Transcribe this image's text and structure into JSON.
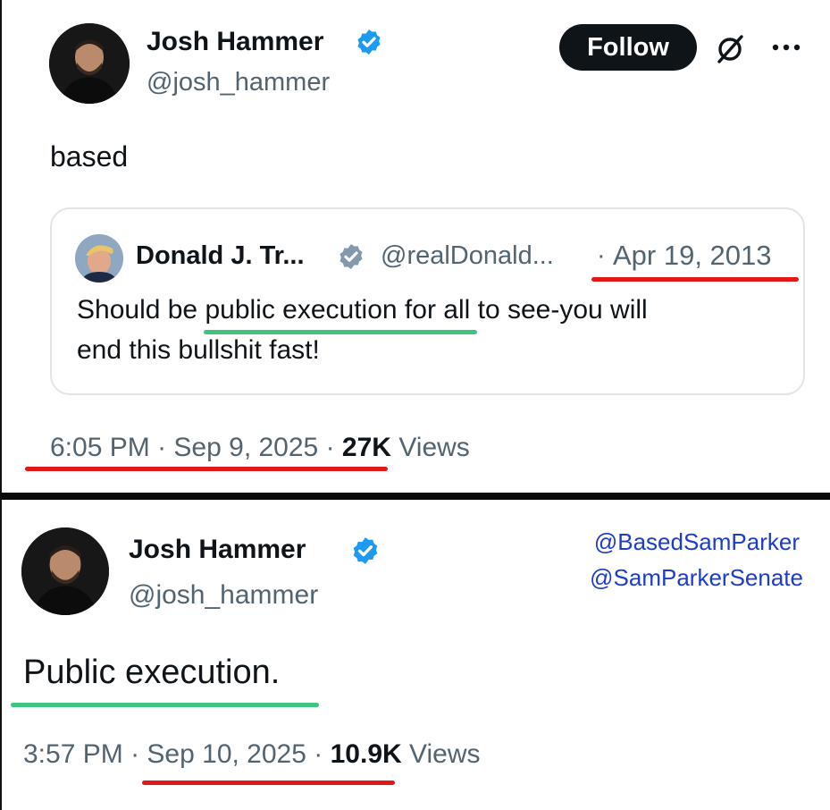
{
  "tweet1": {
    "author_name": "Josh Hammer",
    "author_handle": "@josh_hammer",
    "follow_label": "Follow",
    "text": "based",
    "quote": {
      "author_name": "Donald J. Tr...",
      "author_handle": "@realDonald...",
      "separator": "·",
      "date": "Apr 19, 2013",
      "line1": "Should be public execution for all to see-you will",
      "line2": "end this bullshit fast!"
    },
    "time": "6:05 PM",
    "date": "Sep 9, 2025",
    "views_count": "27K",
    "views_label": "Views"
  },
  "tweet2": {
    "author_name": "Josh Hammer",
    "author_handle": "@josh_hammer",
    "text": "Public execution.",
    "time": "3:57 PM",
    "date": "Sep 10, 2025",
    "views_count": "10.9K",
    "views_label": "Views"
  },
  "tags": [
    "@BasedSamParker",
    "@SamParkerSenate"
  ],
  "separator": "·",
  "colors": {
    "verified_blue": "#1d9bf0",
    "verified_gray": "#829aab",
    "underline_red": "#e01818",
    "underline_green": "#3ec47c",
    "tag_blue": "#1d3ccb"
  },
  "icons": {
    "verified": "verified-badge-icon",
    "grok": "grok-icon",
    "more": "more-options-icon"
  }
}
